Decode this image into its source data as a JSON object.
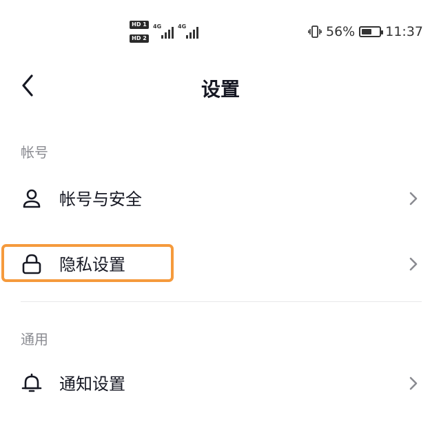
{
  "status_bar": {
    "sim1": "HD 1",
    "sim2": "HD 2",
    "network1": "4G",
    "network2": "4G",
    "battery_percent": "56%",
    "battery_level": 0.56,
    "time": "11:37"
  },
  "header": {
    "title": "设置"
  },
  "sections": {
    "account": {
      "label": "帐号",
      "items": [
        {
          "label": "帐号与安全",
          "icon": "user-icon"
        },
        {
          "label": "隐私设置",
          "icon": "lock-icon"
        }
      ]
    },
    "general": {
      "label": "通用",
      "items": [
        {
          "label": "通知设置",
          "icon": "bell-icon"
        }
      ]
    }
  },
  "colors": {
    "highlight": "#f59a3c",
    "text": "#161823",
    "section_label": "#8a8b91"
  }
}
